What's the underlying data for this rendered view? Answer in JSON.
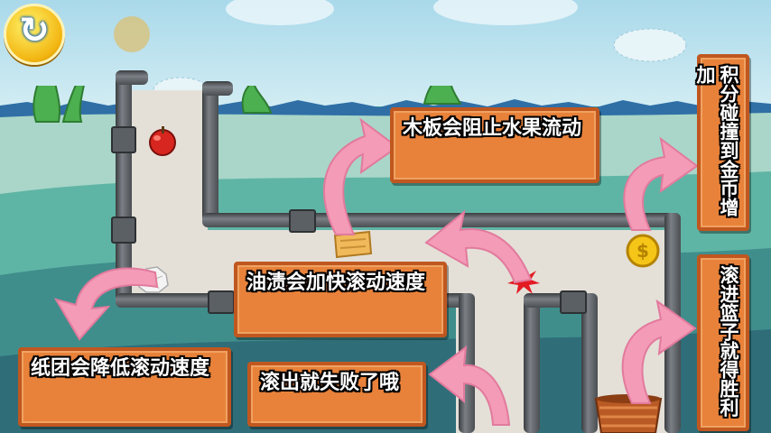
{
  "hud": {
    "restart_icon": "↻"
  },
  "tips": {
    "board": "木板会阻止水果流动",
    "coin": "积分碰撞到金币增加",
    "oil": "油渍会加快滚动速度",
    "paper": "纸团会降低滚动速度",
    "fall": "滚出就失败了哦",
    "basket": "滚进篮子就得胜利"
  },
  "colors": {
    "sign_fill": "#e8823a",
    "sign_border": "#c0571f",
    "arrow": "#f39bb7",
    "sea": "#3f9c92",
    "pipe": "#5b6065"
  },
  "icons": {
    "apple": "apple-icon",
    "coin": "coin-icon",
    "wood_board": "wood-board-icon",
    "paper_ball": "paper-ball-icon",
    "oil_splat": "oil-splat-icon",
    "basket": "basket-icon"
  }
}
